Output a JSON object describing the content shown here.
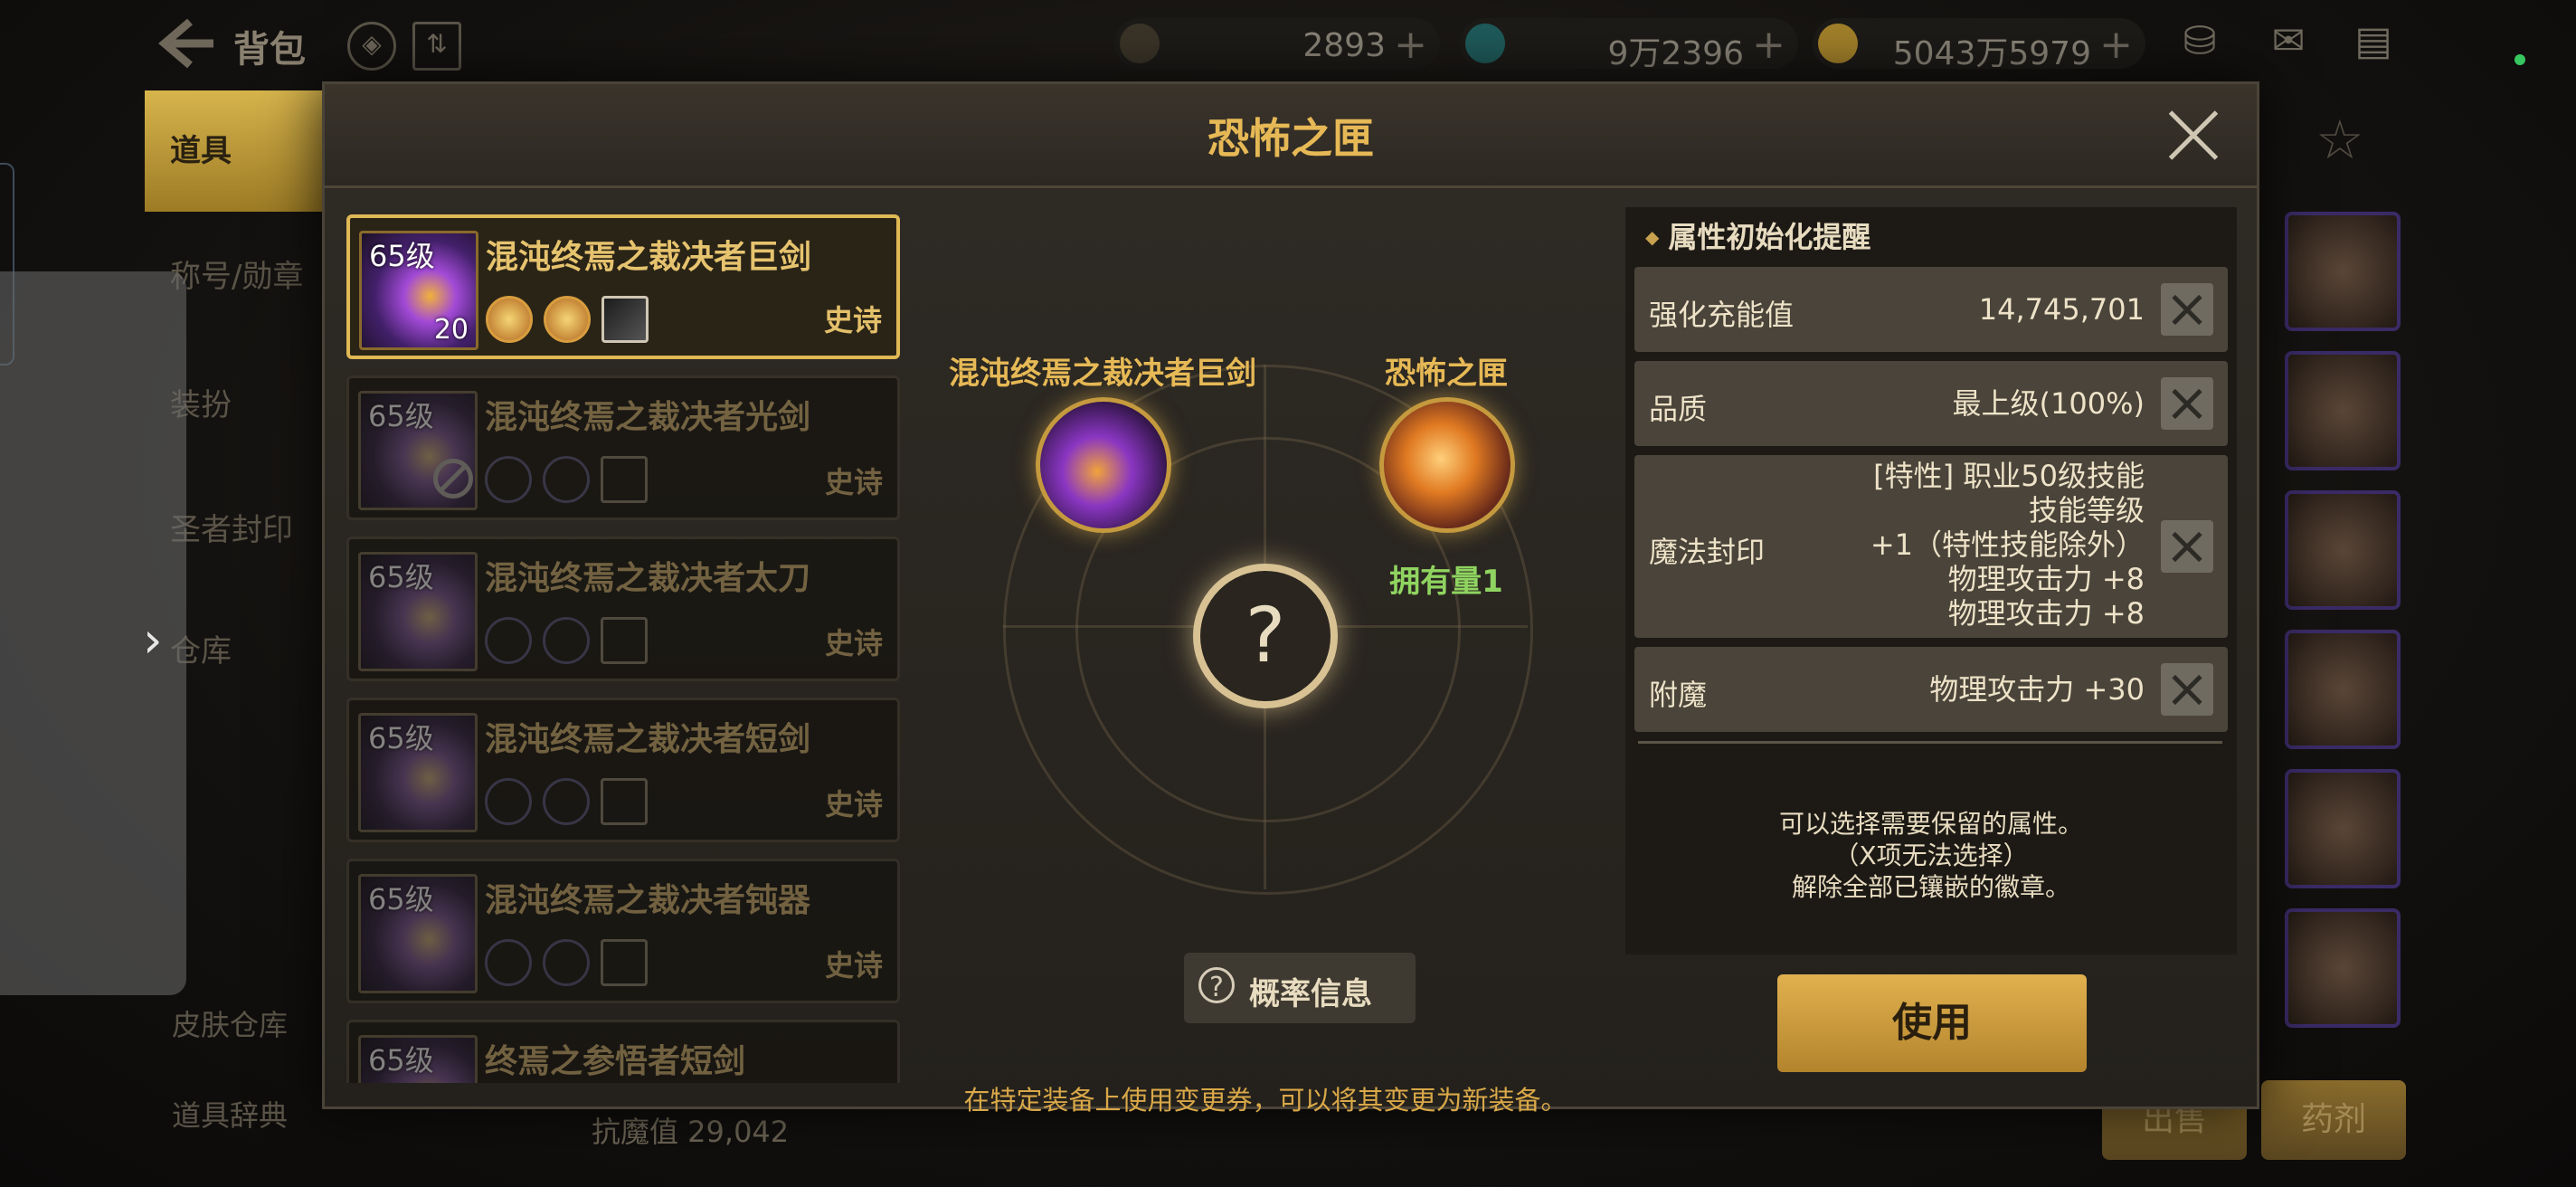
{
  "topbar": {
    "title": "背包",
    "currencies": [
      {
        "icon": "moon-coin-icon",
        "value": "2893"
      },
      {
        "icon": "crystal-icon",
        "value": "9万2396"
      },
      {
        "icon": "gold-coin-icon",
        "value": "5043万5979"
      }
    ],
    "plus": "+"
  },
  "background_menu": {
    "active": "道具",
    "items": [
      "称号/勋章",
      "装扮",
      "圣者封印",
      "仓库"
    ],
    "bottom_items": [
      "皮肤仓库",
      "道具辞典"
    ],
    "stat": "抗魔值 29,042",
    "buttons": [
      "出售",
      "药剂"
    ]
  },
  "modal": {
    "title": "恐怖之匣",
    "items": [
      {
        "level": "65级",
        "name": "混沌终焉之裁决者巨剑",
        "rarity": "史诗",
        "count": "20",
        "selected": true
      },
      {
        "level": "65级",
        "name": "混沌终焉之裁决者光剑",
        "rarity": "史诗",
        "count": "",
        "selected": false
      },
      {
        "level": "65级",
        "name": "混沌终焉之裁决者太刀",
        "rarity": "史诗",
        "count": "",
        "selected": false
      },
      {
        "level": "65级",
        "name": "混沌终焉之裁决者短剑",
        "rarity": "史诗",
        "count": "",
        "selected": false
      },
      {
        "level": "65级",
        "name": "混沌终焉之裁决者钝器",
        "rarity": "史诗",
        "count": "",
        "selected": false
      },
      {
        "level": "65级",
        "name": "终焉之参悟者短剑",
        "rarity": "",
        "count": "",
        "selected": false
      }
    ],
    "source_item_label": "混沌终焉之裁决者巨剑",
    "box_label": "恐怖之匣",
    "owned_label": "拥有量1",
    "result_symbol": "?",
    "probability_button": "概率信息",
    "tip": "在特定装备上使用变更券，可以将其变更为新装备。",
    "attr_panel_title": "属性初始化提醒",
    "attributes": [
      {
        "name": "强化充能值",
        "value_lines": [
          "14,745,701"
        ]
      },
      {
        "name": "品质",
        "value_lines": [
          "最上级(100%)"
        ]
      },
      {
        "name": "魔法封印",
        "value_lines": [
          "[特性] 职业50级技能",
          "技能等级",
          "+1（特性技能除外）",
          "物理攻击力 +8",
          "物理攻击力 +8"
        ]
      },
      {
        "name": "附魔",
        "value_lines": [
          "物理攻击力 +30"
        ]
      }
    ],
    "note_lines": [
      "可以选择需要保留的属性。",
      "（X项无法选择）",
      "解除全部已镶嵌的徽章。"
    ],
    "use_button": "使用"
  },
  "colors": {
    "accent_gold": "#e6b956",
    "owned_green": "#8fd460",
    "use_button": "#d4a443"
  }
}
